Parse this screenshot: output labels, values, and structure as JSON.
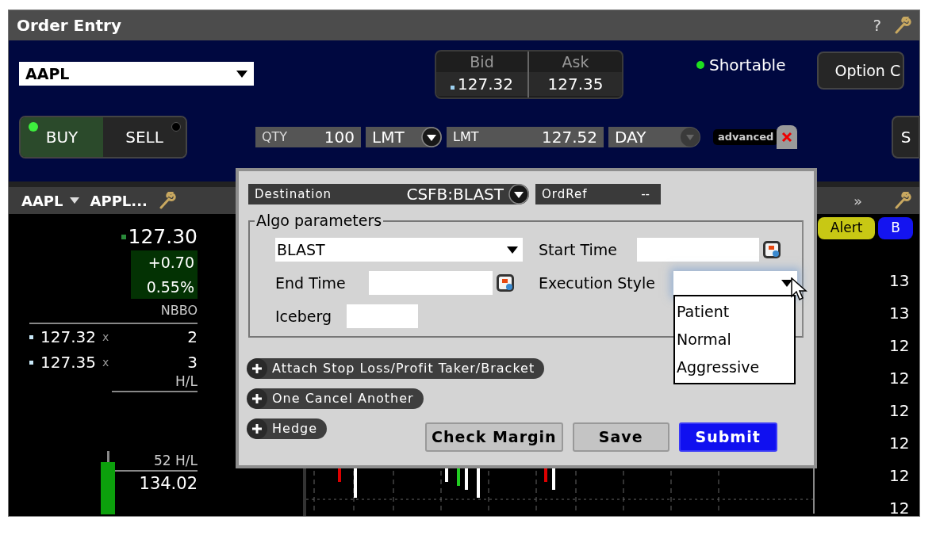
{
  "window": {
    "title": "Order Entry",
    "help": "?"
  },
  "order": {
    "symbol": "AAPL",
    "bid_label": "Bid",
    "bid": "127.32",
    "ask_label": "Ask",
    "ask": "127.35",
    "shortable": "Shortable",
    "option_button": "Option C",
    "side": [
      {
        "label": "BUY",
        "selected": true
      },
      {
        "label": "SELL",
        "selected": false
      }
    ],
    "qty_label": "QTY",
    "qty": "100",
    "order_type": "LMT",
    "price_label": "LMT",
    "price": "127.52",
    "tif": "DAY",
    "advanced": "advanced",
    "right_button": "S"
  },
  "quote_panel": {
    "symbol": "AAPL",
    "name": "APPL...",
    "last": "127.30",
    "change": "+0.70",
    "change_pct": "0.55%",
    "nbbo_label": "NBBO",
    "book": [
      {
        "price": "127.32",
        "x": "x",
        "size": "2"
      },
      {
        "price": "127.35",
        "x": "x",
        "size": "3"
      }
    ],
    "hl_label": "H/L",
    "w52_label": "52 H/L",
    "w52_high": "134.02"
  },
  "chart_panel": {
    "more": "»",
    "buttons": [
      {
        "label": "Alert",
        "color": "#c8c814"
      },
      {
        "label": "B",
        "color": "#1414f0"
      }
    ],
    "axis_labels": [
      "13",
      "13",
      "12",
      "12",
      "12",
      "12",
      "12",
      "12"
    ]
  },
  "advanced_panel": {
    "destination_label": "Destination",
    "destination": "CSFB:BLAST",
    "ordref_label": "OrdRef",
    "ordref": "--",
    "algo_title": "Algo parameters",
    "algo": "BLAST",
    "start_time": {
      "label": "Start Time"
    },
    "end_time": {
      "label": "End Time"
    },
    "iceberg": {
      "label": "Iceberg"
    },
    "execution_style": {
      "label": "Execution Style",
      "expanded": true,
      "options": [
        "Patient",
        "Normal",
        "Aggressive"
      ]
    },
    "sections": [
      "Attach Stop Loss/Profit Taker/Bracket",
      "One Cancel Another",
      "Hedge"
    ],
    "buttons": [
      {
        "label": "Check Margin",
        "kind": "default"
      },
      {
        "label": "Save",
        "kind": "default"
      },
      {
        "label": "Submit",
        "kind": "primary"
      }
    ]
  }
}
